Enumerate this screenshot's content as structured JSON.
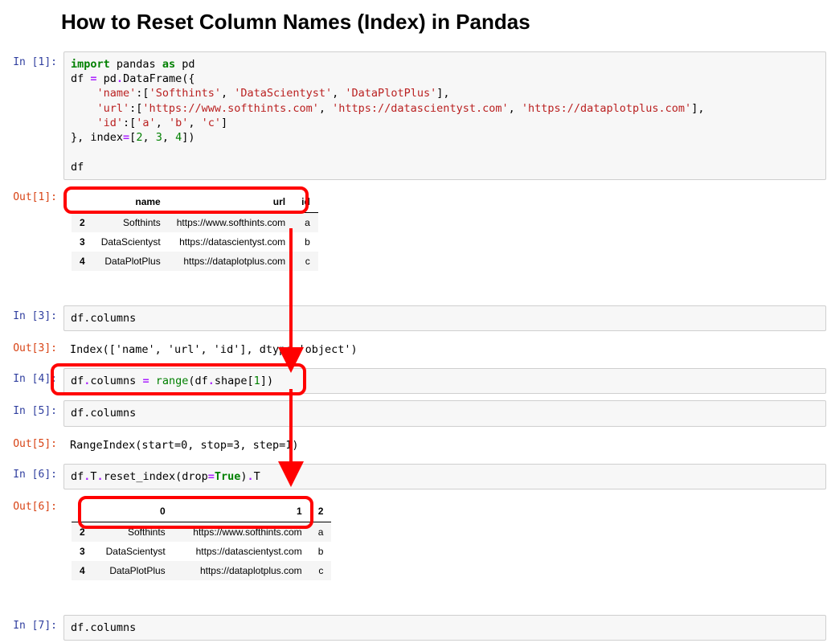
{
  "title": "How to Reset Column Names (Index) in Pandas",
  "cells": {
    "in1": {
      "prompt": "In [1]:"
    },
    "out1": {
      "prompt": "Out[1]:"
    },
    "in3": {
      "prompt": "In [3]:",
      "code": "df.columns"
    },
    "out3": {
      "prompt": "Out[3]:",
      "text": "Index(['name', 'url', 'id'], dtype='object')"
    },
    "in4": {
      "prompt": "In [4]:"
    },
    "in5": {
      "prompt": "In [5]:",
      "code": "df.columns"
    },
    "out5": {
      "prompt": "Out[5]:",
      "text": "RangeIndex(start=0, stop=3, step=1)"
    },
    "in6": {
      "prompt": "In [6]:"
    },
    "out6": {
      "prompt": "Out[6]:"
    },
    "in7": {
      "prompt": "In [7]:",
      "code": "df.columns"
    }
  },
  "code1": {
    "l1a": "import",
    "l1b": " pandas ",
    "l1c": "as",
    "l1d": " pd",
    "l2a": "df ",
    "l2b": "=",
    "l2c": " pd",
    "l2d": ".",
    "l2e": "DataFrame({",
    "l3a": "    ",
    "l3b": "'name'",
    "l3c": ":[",
    "l3d": "'Softhints'",
    "l3e": ", ",
    "l3f": "'DataScientyst'",
    "l3g": ", ",
    "l3h": "'DataPlotPlus'",
    "l3i": "],",
    "l4a": "    ",
    "l4b": "'url'",
    "l4c": ":[",
    "l4d": "'https://www.softhints.com'",
    "l4e": ", ",
    "l4f": "'https://datascientyst.com'",
    "l4g": ", ",
    "l4h": "'https://dataplotplus.com'",
    "l4i": "],",
    "l5a": "    ",
    "l5b": "'id'",
    "l5c": ":[",
    "l5d": "'a'",
    "l5e": ", ",
    "l5f": "'b'",
    "l5g": ", ",
    "l5h": "'c'",
    "l5i": "]",
    "l6a": "}, index",
    "l6b": "=",
    "l6c": "[",
    "l6d": "2",
    "l6e": ", ",
    "l6f": "3",
    "l6g": ", ",
    "l6h": "4",
    "l6i": "])",
    "l7": "",
    "l8": "df"
  },
  "code4": {
    "a": "df",
    "b": ".",
    "c": "columns ",
    "d": "=",
    "e": " ",
    "f": "range",
    "g": "(df",
    "h": ".",
    "i": "shape[",
    "j": "1",
    "k": "])"
  },
  "code6": {
    "a": "df",
    "b": ".",
    "c": "T",
    "d": ".",
    "e": "reset_index(drop",
    "f": "=",
    "g": "True",
    "h": ")",
    "i": ".",
    "j": "T"
  },
  "table1": {
    "headers": [
      "",
      "name",
      "url",
      "id"
    ],
    "rows": [
      {
        "idx": "2",
        "c0": "Softhints",
        "c1": "https://www.softhints.com",
        "c2": "a"
      },
      {
        "idx": "3",
        "c0": "DataScientyst",
        "c1": "https://datascientyst.com",
        "c2": "b"
      },
      {
        "idx": "4",
        "c0": "DataPlotPlus",
        "c1": "https://dataplotplus.com",
        "c2": "c"
      }
    ]
  },
  "table6": {
    "headers": [
      "",
      "0",
      "1",
      "2"
    ],
    "rows": [
      {
        "idx": "2",
        "c0": "Softhints",
        "c1": "https://www.softhints.com",
        "c2": "a"
      },
      {
        "idx": "3",
        "c0": "DataScientyst",
        "c1": "https://datascientyst.com",
        "c2": "b"
      },
      {
        "idx": "4",
        "c0": "DataPlotPlus",
        "c1": "https://dataplotplus.com",
        "c2": "c"
      }
    ]
  }
}
